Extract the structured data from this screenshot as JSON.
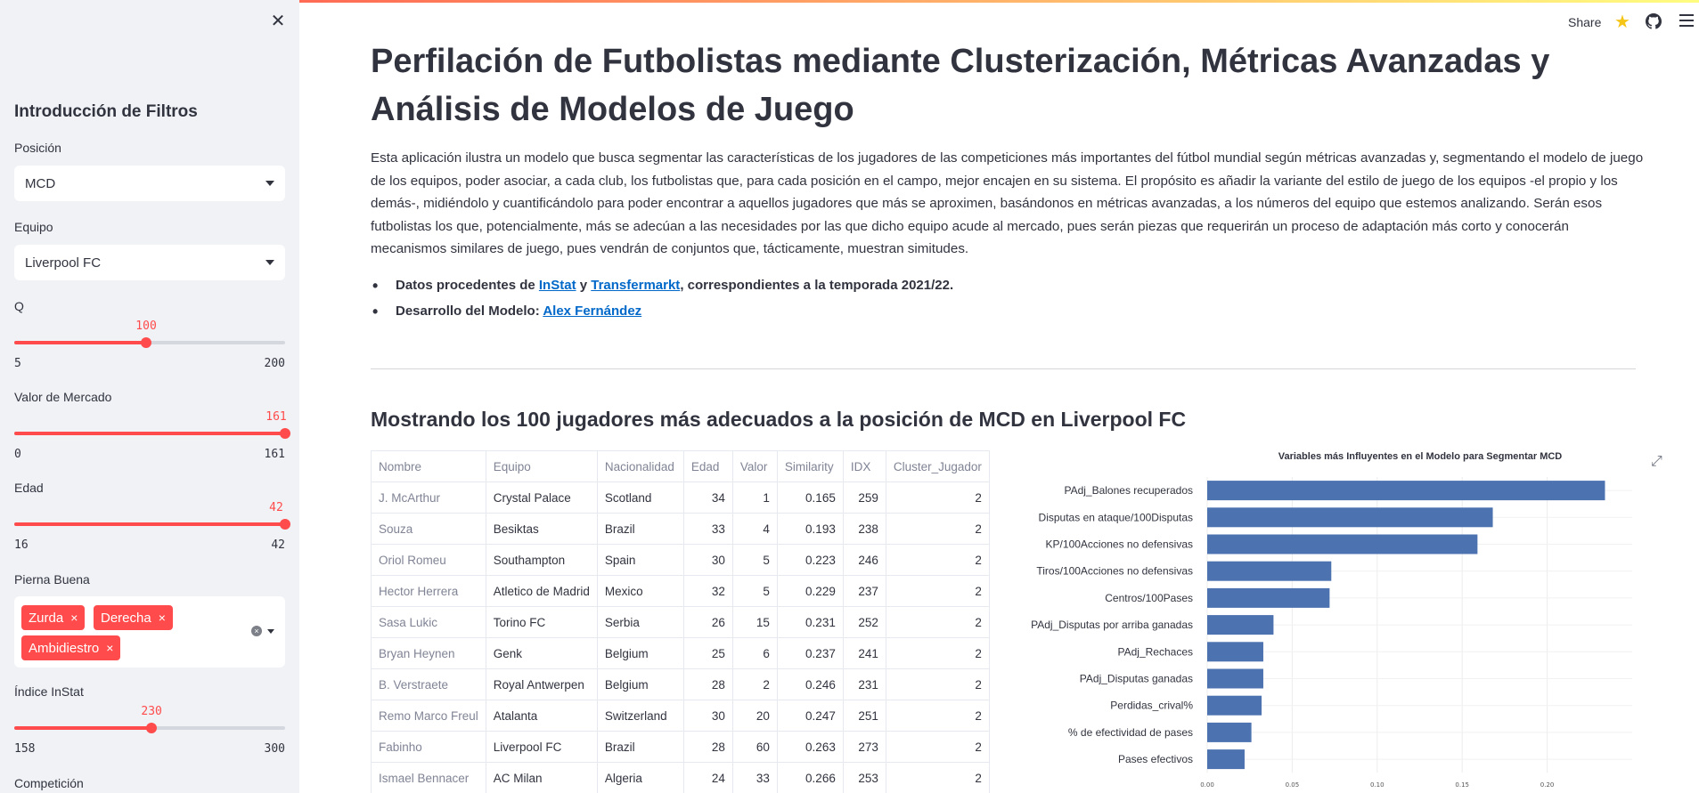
{
  "sidebar": {
    "title": "Introducción de Filtros",
    "posicion": {
      "label": "Posición",
      "value": "MCD"
    },
    "equipo": {
      "label": "Equipo",
      "value": "Liverpool FC"
    },
    "q": {
      "label": "Q",
      "value": "100",
      "min": "5",
      "max": "200",
      "level": 0.487
    },
    "valor": {
      "label": "Valor de Mercado",
      "value": "161",
      "min": "0",
      "max": "161",
      "level": 1.0
    },
    "edad": {
      "label": "Edad",
      "value": "42",
      "min": "16",
      "max": "42",
      "level": 1.0
    },
    "pierna": {
      "label": "Pierna Buena",
      "tags": [
        "Zurda",
        "Derecha",
        "Ambidiestro"
      ],
      "remove": "×"
    },
    "instat": {
      "label": "Índice InStat",
      "value": "230",
      "min": "158",
      "max": "300",
      "level": 0.507
    },
    "competicion": {
      "label": "Competición"
    }
  },
  "header": {
    "share": "Share"
  },
  "main": {
    "title": "Perfilación de Futbolistas mediante Clusterización, Métricas Avanzadas y Análisis de Modelos de Juego",
    "intro": "Esta aplicación ilustra un modelo que busca segmentar las características de los jugadores de las competiciones más importantes del fútbol mundial según métricas avanzadas y, segmentando el modelo de juego de los equipos, poder asociar, a cada club, los futbolistas que, para cada posición en el campo, mejor encajen en su sistema. El propósito es añadir la variante del estilo de juego de los equipos -el propio y los demás-, midiéndolo y cuantificándolo para poder encontrar a aquellos jugadores que más se aproximen, basándonos en métricas avanzadas, a los números del equipo que estemos analizando. Serán esos futbolistas los que, potencialmente, más se adecúan a las necesidades por las que dicho equipo acude al mercado, pues serán piezas que requerirán un proceso de adaptación más corto y conocerán mecanismos similares de juego, pues vendrán de conjuntos que, tácticamente, muestran simitudes.",
    "bullet1": {
      "prefix": "Datos procedentes de ",
      "link1": "InStat",
      "mid": " y ",
      "link2": "Transfermarkt",
      "suffix": ", correspondientes a la temporada 2021/22."
    },
    "bullet2": {
      "prefix": "Desarrollo del Modelo: ",
      "link": "Alex Fernández"
    },
    "subtitle": "Mostrando los 100 jugadores más adecuados a la posición de MCD en Liverpool FC"
  },
  "table": {
    "columns": [
      "Nombre",
      "Equipo",
      "Nacionalidad",
      "Edad",
      "Valor",
      "Similarity",
      "IDX",
      "Cluster_Jugador"
    ],
    "rows": [
      [
        "J. McArthur",
        "Crystal Palace",
        "Scotland",
        "34",
        "1",
        "0.165",
        "259",
        "2"
      ],
      [
        "Souza",
        "Besiktas",
        "Brazil",
        "33",
        "4",
        "0.193",
        "238",
        "2"
      ],
      [
        "Oriol Romeu",
        "Southampton",
        "Spain",
        "30",
        "5",
        "0.223",
        "246",
        "2"
      ],
      [
        "Hector Herrera",
        "Atletico de Madrid",
        "Mexico",
        "32",
        "5",
        "0.229",
        "237",
        "2"
      ],
      [
        "Sasa Lukic",
        "Torino FC",
        "Serbia",
        "26",
        "15",
        "0.231",
        "252",
        "2"
      ],
      [
        "Bryan Heynen",
        "Genk",
        "Belgium",
        "25",
        "6",
        "0.237",
        "241",
        "2"
      ],
      [
        "B. Verstraete",
        "Royal Antwerpen",
        "Belgium",
        "28",
        "2",
        "0.246",
        "231",
        "2"
      ],
      [
        "Remo Marco Freul",
        "Atalanta",
        "Switzerland",
        "30",
        "20",
        "0.247",
        "251",
        "2"
      ],
      [
        "Fabinho",
        "Liverpool FC",
        "Brazil",
        "28",
        "60",
        "0.263",
        "273",
        "2"
      ],
      [
        "Ismael Bennacer",
        "AC Milan",
        "Algeria",
        "24",
        "33",
        "0.266",
        "253",
        "2"
      ]
    ]
  },
  "chart_data": {
    "type": "bar",
    "orientation": "horizontal",
    "title": "Variables más Influyentes en el Modelo para Segmentar MCD",
    "categories": [
      "PAdj_Balones recuperados",
      "Disputas en ataque/100Disputas",
      "KP/100Acciones no defensivas",
      "Tiros/100Acciones no defensivas",
      "Centros/100Pases",
      "PAdj_Disputas por arriba ganadas",
      "PAdj_Rechaces",
      "PAdj_Disputas ganadas",
      "Perdidas_crival%",
      "% de efectividad de pases",
      "Pases efectivos"
    ],
    "values": [
      0.234,
      0.168,
      0.159,
      0.073,
      0.072,
      0.039,
      0.033,
      0.033,
      0.032,
      0.026,
      0.022
    ],
    "xticks": [
      "0.00",
      "0.05",
      "0.10",
      "0.15",
      "0.20"
    ],
    "xlim": [
      0,
      0.25
    ],
    "grid": true,
    "color": "#4c72b0"
  }
}
